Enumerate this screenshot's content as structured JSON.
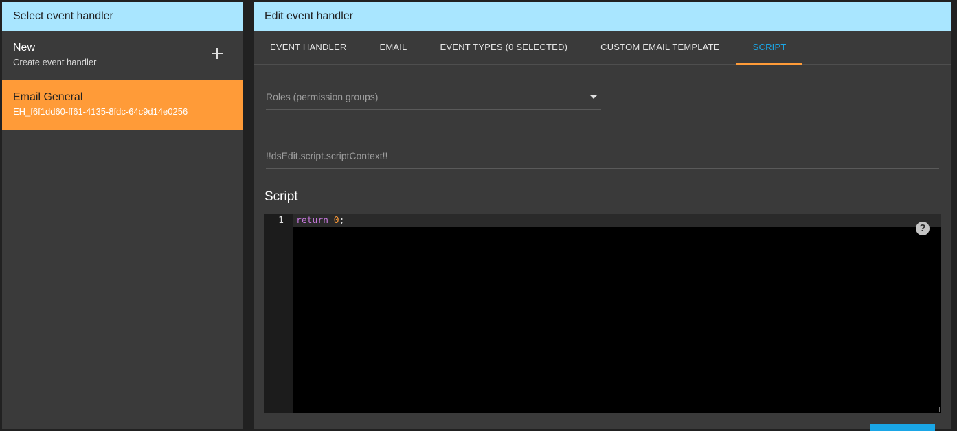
{
  "left_panel": {
    "title": "Select event handler",
    "new_item": {
      "primary": "New",
      "secondary": "Create event handler",
      "icon": "plus-icon"
    },
    "items": [
      {
        "primary": "Email General",
        "secondary": "EH_f6f1dd60-ff61-4135-8fdc-64c9d14e0256",
        "selected": true
      }
    ]
  },
  "right_panel": {
    "title": "Edit event handler",
    "tabs": [
      {
        "label": "EVENT HANDLER"
      },
      {
        "label": "EMAIL"
      },
      {
        "label": "EVENT TYPES (0 SELECTED)"
      },
      {
        "label": "CUSTOM EMAIL TEMPLATE"
      },
      {
        "label": "SCRIPT",
        "active": true
      }
    ],
    "roles_placeholder": "Roles (permission groups)",
    "context_placeholder": "!!dsEdit.script.scriptContext!!",
    "script_heading": "Script",
    "editor": {
      "line_number": "1",
      "code_keyword": "return",
      "code_number": "0",
      "code_punct": ";"
    },
    "help_icon": "?"
  },
  "colors": {
    "header_bg": "#a9e6ff",
    "selected_bg": "#ff9b38",
    "accent_blue": "#1aa6e6",
    "panel_bg": "#3a3a3a"
  }
}
